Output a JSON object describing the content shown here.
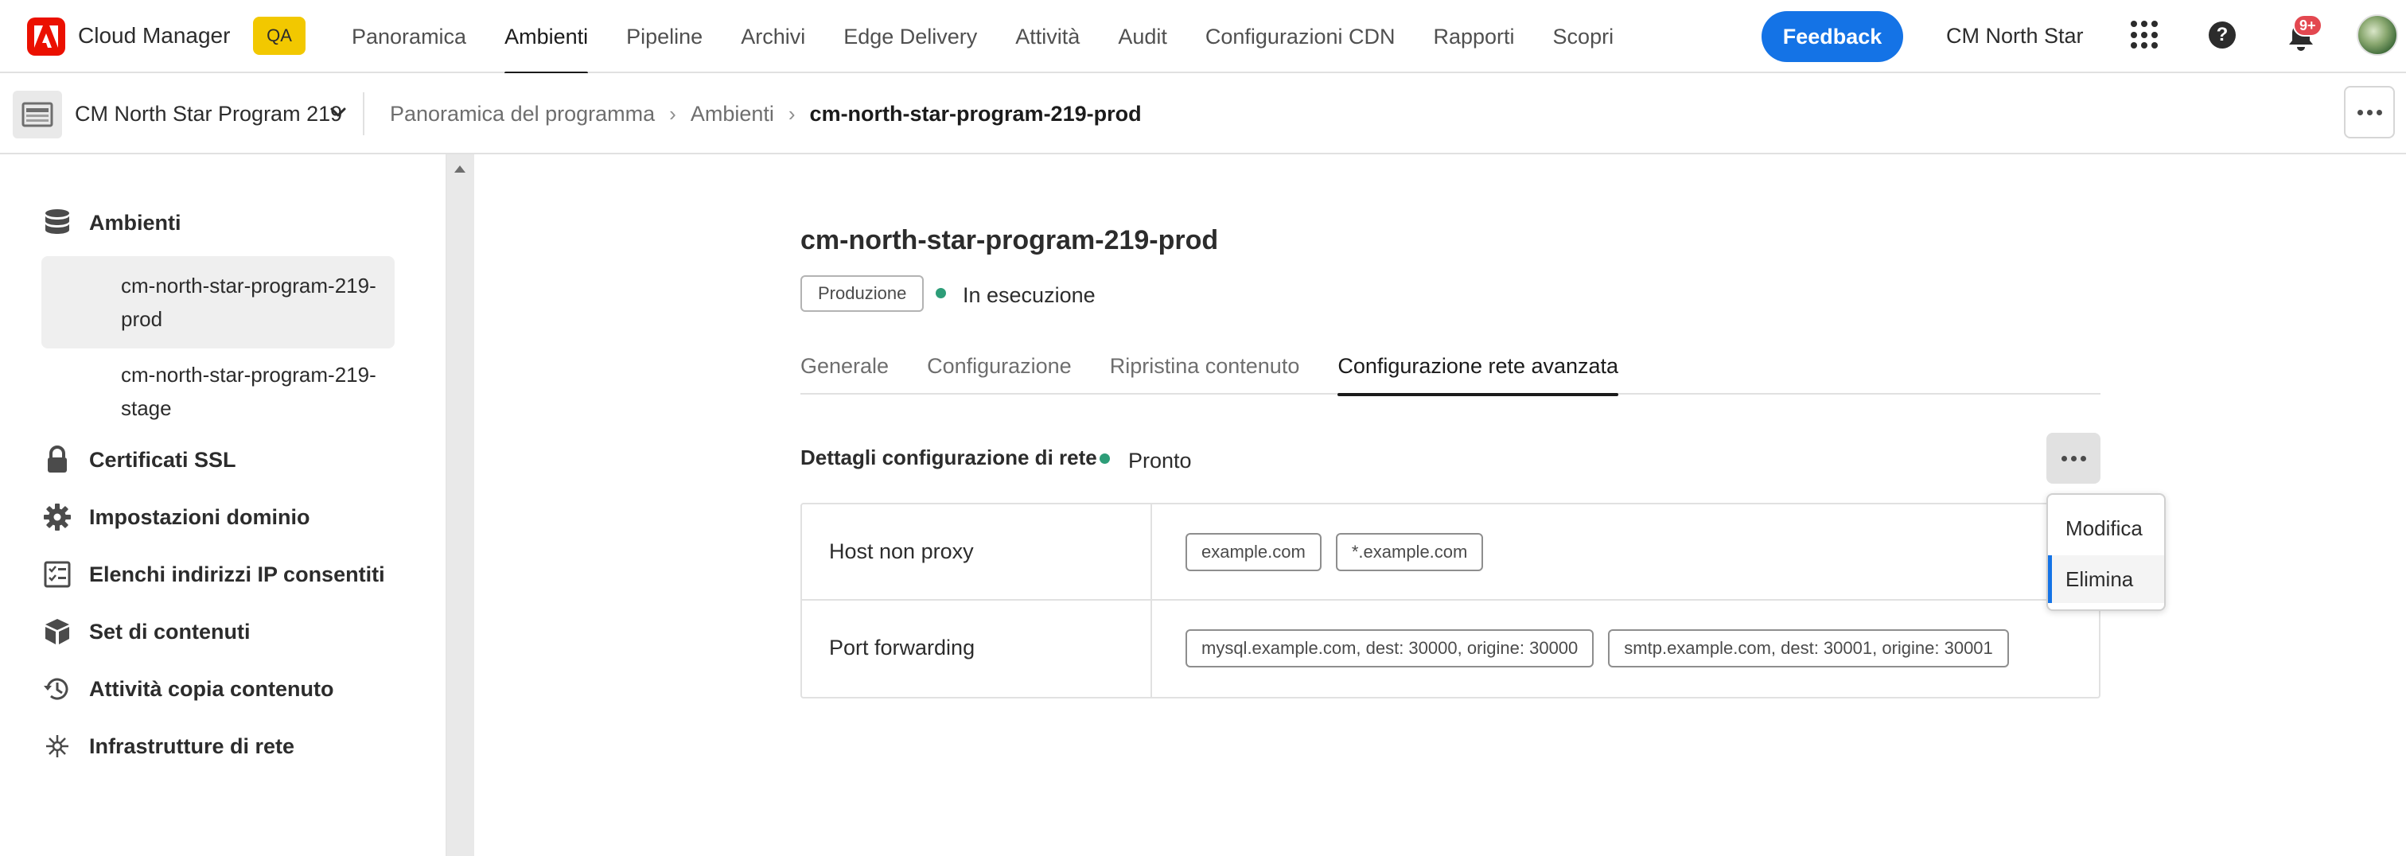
{
  "topbar": {
    "app_title": "Cloud Manager",
    "env_badge": "QA",
    "nav_items": [
      "Panoramica",
      "Ambienti",
      "Pipeline",
      "Archivi",
      "Edge Delivery",
      "Attività",
      "Audit",
      "Configurazioni CDN",
      "Rapporti",
      "Scopri"
    ],
    "active_nav": "Ambienti",
    "feedback_label": "Feedback",
    "org_name": "CM North Star",
    "notification_count": "9+",
    "icons": [
      "adobe-logo-icon",
      "app-switcher-icon",
      "help-icon",
      "bell-icon",
      "avatar"
    ]
  },
  "subbar": {
    "program_name": "CM North Star Program 219",
    "breadcrumb": [
      "Panoramica del programma",
      "Ambienti",
      "cm-north-star-program-219-prod"
    ]
  },
  "sidebar": {
    "environments_label": "Ambienti",
    "environments": [
      "cm-north-star-program-219-prod",
      "cm-north-star-program-219-stage"
    ],
    "selected_environment": "cm-north-star-program-219-prod",
    "items": [
      "Certificati SSL",
      "Impostazioni dominio",
      "Elenchi indirizzi IP consentiti",
      "Set di contenuti",
      "Attività copia contenuto",
      "Infrastrutture di rete"
    ]
  },
  "main": {
    "environment_title": "cm-north-star-program-219-prod",
    "environment_type": "Produzione",
    "environment_status": "In esecuzione",
    "tabs": [
      "Generale",
      "Configurazione",
      "Ripristina contenuto",
      "Configurazione rete avanzata"
    ],
    "active_tab": "Configurazione rete avanzata",
    "section_title": "Dettagli configurazione di rete",
    "section_status": "Pronto",
    "rows": [
      {
        "label": "Host non proxy",
        "values": [
          "example.com",
          "*.example.com"
        ]
      },
      {
        "label": "Port forwarding",
        "values": [
          "mysql.example.com, dest: 30000, origine: 30000",
          "smtp.example.com, dest: 30001, origine: 30001"
        ]
      }
    ],
    "actions_menu": [
      "Modifica",
      "Elimina"
    ]
  },
  "colors": {
    "adobe_red": "#eb1000",
    "qa_yellow": "#f2c800",
    "feedback_blue": "#1473e6",
    "status_green": "#2d9d78",
    "notification_red": "#e34850"
  }
}
